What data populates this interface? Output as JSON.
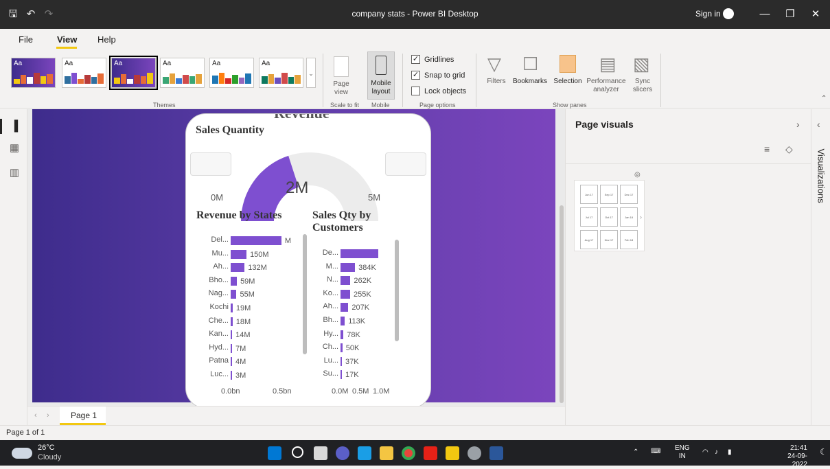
{
  "window": {
    "title": "company stats - Power BI Desktop",
    "sign_in": "Sign in"
  },
  "menu": {
    "file": "File",
    "view": "View",
    "help": "Help"
  },
  "ribbon": {
    "theme_aa": "Aa",
    "themes_label": "Themes",
    "page_view_label": "Page view",
    "scale_to_fit_label": "Scale to fit",
    "mobile_layout_label": "Mobile layout",
    "mobile_group_label": "Mobile",
    "gridlines": "Gridlines",
    "snap_to_grid": "Snap to grid",
    "lock_objects": "Lock objects",
    "page_options_label": "Page options",
    "filters": "Filters",
    "bookmarks": "Bookmarks",
    "selection": "Selection",
    "performance_analyzer": "Performance analyzer",
    "sync_slicers": "Sync slicers",
    "show_panes_label": "Show panes",
    "gridlines_checked": true,
    "snap_checked": true,
    "lock_checked": false
  },
  "canvas": {
    "revenue_peek": "Revenue",
    "gauge": {
      "title": "Sales Quantity",
      "min_label": "0M",
      "max_label": "5M",
      "value_label": "2M",
      "fill_fraction": 0.4
    },
    "states_title": "Revenue by States",
    "customers_title": "Sales Qty by Customers"
  },
  "chart_data": [
    {
      "type": "bar",
      "title": "Revenue by States",
      "categories": [
        "Del...",
        "Mu...",
        "Ah...",
        "Bho...",
        "Nag...",
        "Kochi",
        "Che...",
        "Kan...",
        "Hyd...",
        "Patna",
        "Luc..."
      ],
      "values": [
        480,
        150,
        132,
        59,
        55,
        19,
        18,
        14,
        7,
        4,
        3
      ],
      "value_labels": [
        "M",
        "150M",
        "132M",
        "59M",
        "55M",
        "19M",
        "18M",
        "14M",
        "7M",
        "4M",
        "3M"
      ],
      "x_ticks": [
        "0.0bn",
        "0.5bn"
      ],
      "xlim": [
        0,
        650
      ]
    },
    {
      "type": "bar",
      "title": "Sales Qty by Customers",
      "categories": [
        "De...",
        "M...",
        "N...",
        "Ko...",
        "Ah...",
        "Bh...",
        "Hy...",
        "Ch...",
        "Lu...",
        "Su..."
      ],
      "values": [
        1000,
        384,
        262,
        255,
        207,
        113,
        78,
        50,
        37,
        17
      ],
      "value_labels": [
        "",
        "384K",
        "262K",
        "255K",
        "207K",
        "113K",
        "78K",
        "50K",
        "37K",
        "17K"
      ],
      "x_ticks": [
        "0.0M",
        "0.5M",
        "1.0M"
      ],
      "xlim": [
        0,
        1200
      ]
    }
  ],
  "pages": {
    "tab": "Page 1",
    "status": "Page 1 of 1"
  },
  "right_pane": {
    "title": "Page visuals",
    "vertical_tab": "Visualizations",
    "slicer_dates": [
      "Jun 17",
      "Sep 17",
      "Dec 17",
      "Jul 17",
      "Oct 17",
      "Jan 18",
      "Aug 17",
      "Nov 17",
      "Feb 18"
    ]
  },
  "taskbar": {
    "temp": "26°C",
    "condition": "Cloudy",
    "lang_top": "ENG",
    "lang_bottom": "IN",
    "time": "21:41",
    "date": "24-09-2022"
  },
  "colors": {
    "accent_yellow": "#f2c811",
    "bar_purple": "#7e4fd0",
    "titlebar": "#2b2b2b"
  }
}
